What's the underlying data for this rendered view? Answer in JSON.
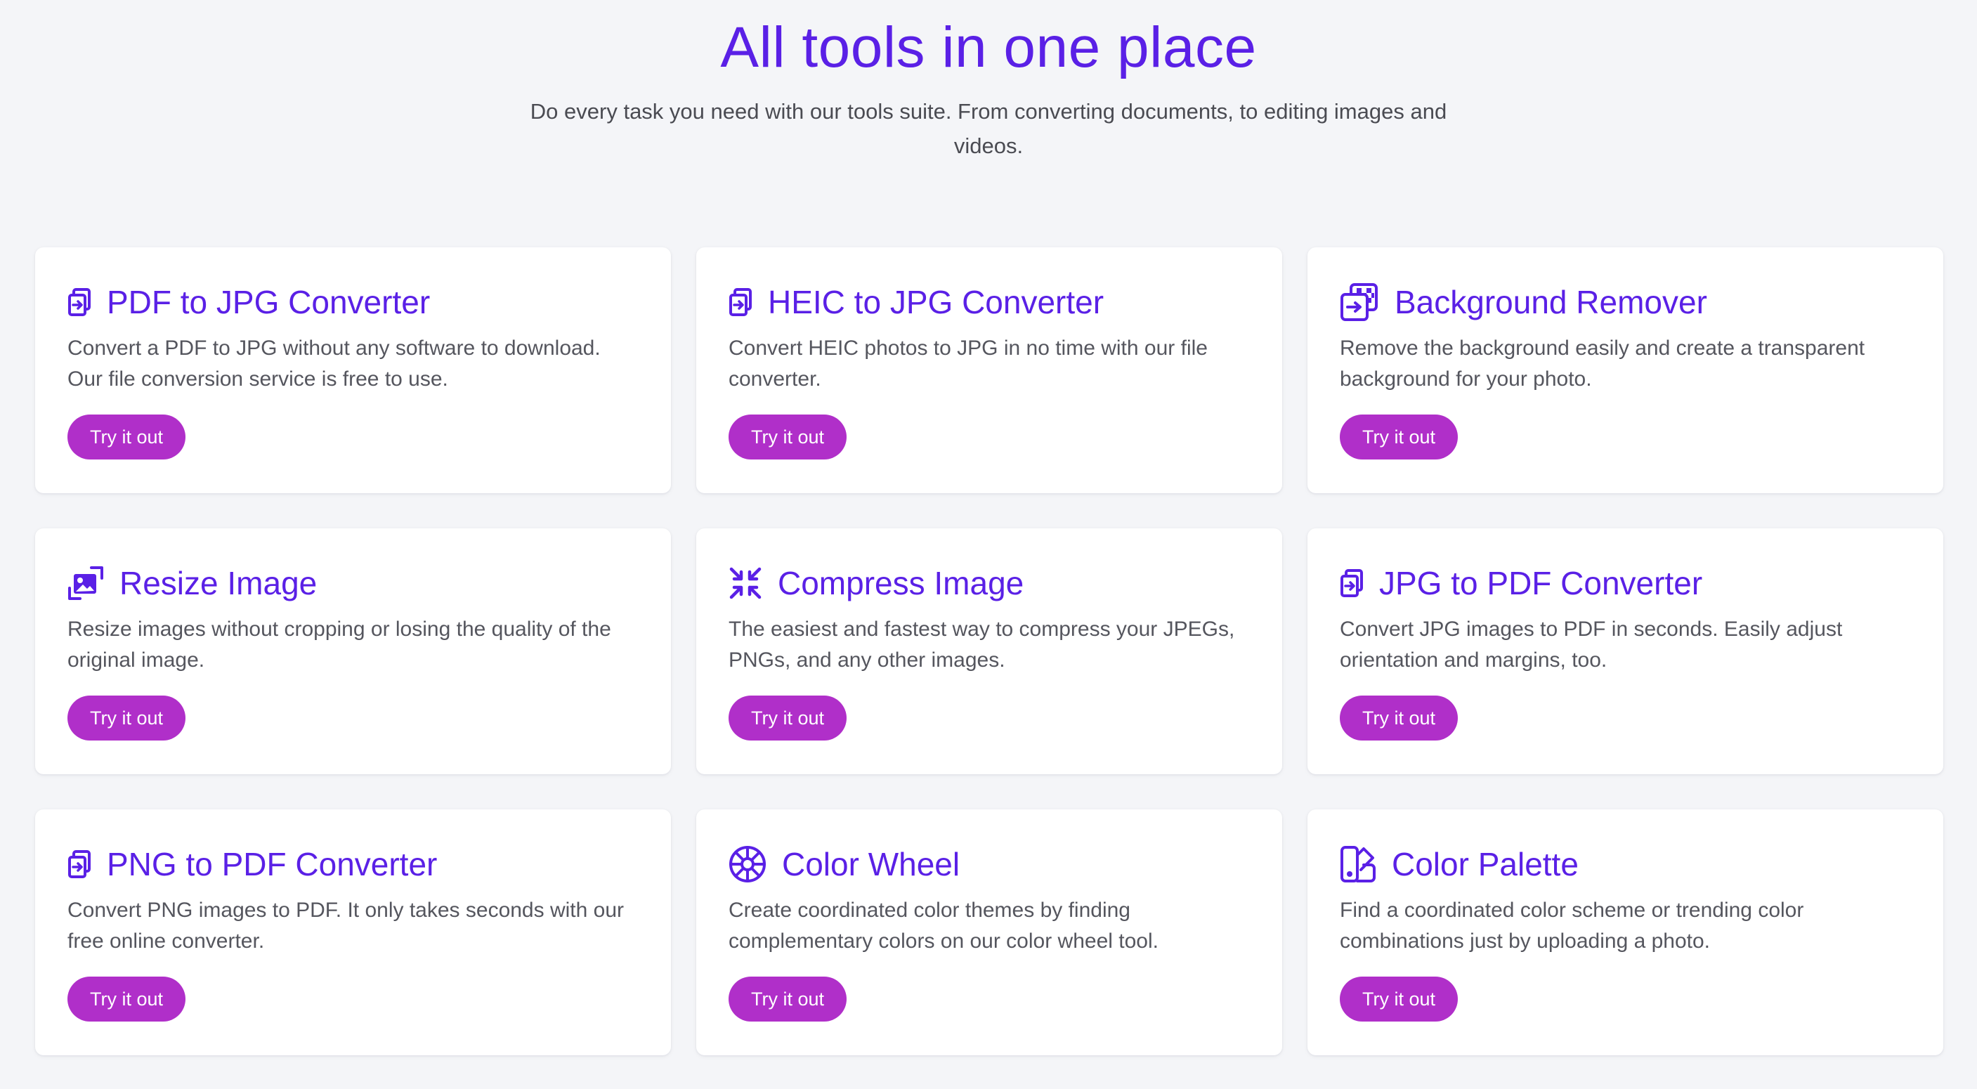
{
  "hero": {
    "title": "All tools in one place",
    "subtitle": "Do every task you need with our tools suite. From converting documents, to editing images and videos."
  },
  "colors": {
    "accent": "#5a20e6",
    "button": "#b02fc9",
    "background": "#f4f5f8",
    "card": "#ffffff",
    "text": "#55565e"
  },
  "tools": [
    {
      "title": "PDF to JPG Converter",
      "description": "Convert a PDF to JPG without any software to download. Our file conversion service is free to use.",
      "button": "Try it out",
      "icon": "file-convert-icon"
    },
    {
      "title": "HEIC to JPG Converter",
      "description": "Convert HEIC photos to JPG in no time with our file converter.",
      "button": "Try it out",
      "icon": "file-convert-icon"
    },
    {
      "title": "Background Remover",
      "description": "Remove the background easily and create a transparent background for your photo.",
      "button": "Try it out",
      "icon": "background-remover-icon"
    },
    {
      "title": "Resize Image",
      "description": "Resize images without cropping or losing the quality of the original image.",
      "button": "Try it out",
      "icon": "resize-image-icon"
    },
    {
      "title": "Compress Image",
      "description": "The easiest and fastest way to compress your JPEGs, PNGs, and any other images.",
      "button": "Try it out",
      "icon": "compress-icon"
    },
    {
      "title": "JPG to PDF Converter",
      "description": "Convert JPG images to PDF in seconds. Easily adjust orientation and margins, too.",
      "button": "Try it out",
      "icon": "file-convert-icon"
    },
    {
      "title": "PNG to PDF Converter",
      "description": "Convert PNG images to PDF. It only takes seconds with our free online converter.",
      "button": "Try it out",
      "icon": "file-convert-icon"
    },
    {
      "title": "Color Wheel",
      "description": "Create coordinated color themes by finding complementary colors on our color wheel tool.",
      "button": "Try it out",
      "icon": "color-wheel-icon"
    },
    {
      "title": "Color Palette",
      "description": "Find a coordinated color scheme or trending color combinations just by uploading a photo.",
      "button": "Try it out",
      "icon": "color-palette-icon"
    }
  ]
}
